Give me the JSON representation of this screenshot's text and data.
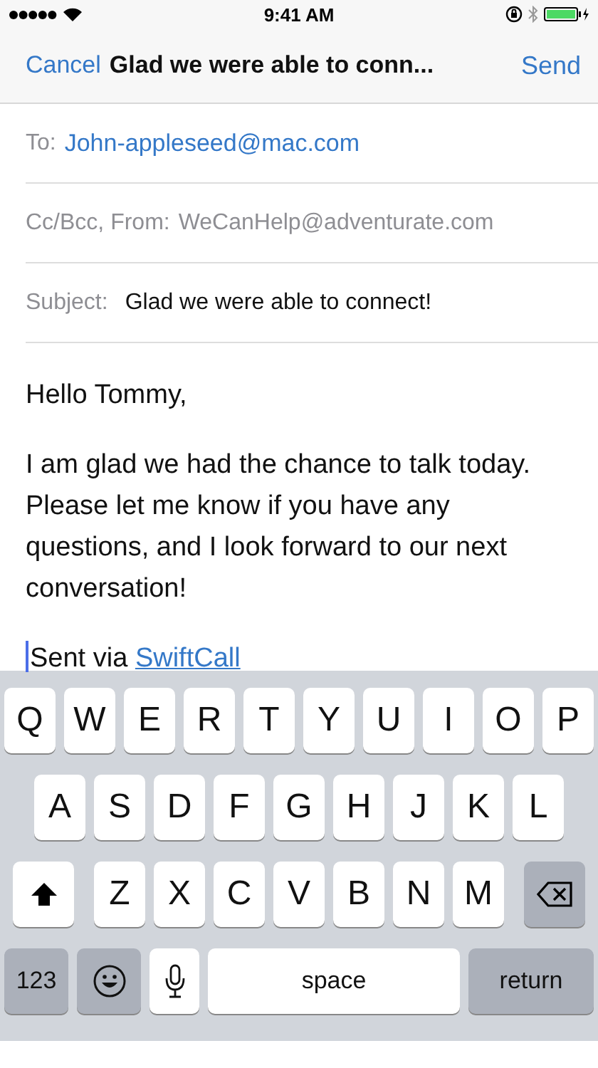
{
  "status_bar": {
    "time": "9:41 AM"
  },
  "nav": {
    "cancel": "Cancel",
    "title": "Glad we were able to conn...",
    "send": "Send"
  },
  "fields": [
    {
      "label": "To:",
      "value": "John-appleseed@mac.com",
      "kind": "recipient"
    },
    {
      "label": "Cc/Bcc, From:",
      "value": "WeCanHelp@adventurate.com",
      "kind": "muted"
    },
    {
      "label": "Subject:",
      "value": "Glad we were able to connect!",
      "kind": "plain"
    }
  ],
  "body": {
    "greeting": "Hello Tommy,",
    "paragraph": "I am glad we had the chance to talk today. Please let me know if you have any questions, and I look forward to our next conversation!",
    "signature": {
      "text": "Sent via",
      "link": "SwiftCall"
    }
  },
  "keyboard": {
    "rows": [
      {
        "keys": [
          {
            "kind": "letter",
            "label": "Q"
          },
          {
            "kind": "letter",
            "label": "W"
          },
          {
            "kind": "letter",
            "label": "E"
          },
          {
            "kind": "letter",
            "label": "R"
          },
          {
            "kind": "letter",
            "label": "T"
          },
          {
            "kind": "letter",
            "label": "Y"
          },
          {
            "kind": "letter",
            "label": "U"
          },
          {
            "kind": "letter",
            "label": "I"
          },
          {
            "kind": "letter",
            "label": "O"
          },
          {
            "kind": "letter",
            "label": "P"
          }
        ]
      },
      {
        "keys": [
          {
            "kind": "letter",
            "label": "A"
          },
          {
            "kind": "letter",
            "label": "S"
          },
          {
            "kind": "letter",
            "label": "D"
          },
          {
            "kind": "letter",
            "label": "F"
          },
          {
            "kind": "letter",
            "label": "G"
          },
          {
            "kind": "letter",
            "label": "H"
          },
          {
            "kind": "letter",
            "label": "J"
          },
          {
            "kind": "letter",
            "label": "K"
          },
          {
            "kind": "letter",
            "label": "L"
          }
        ]
      },
      {
        "keys": [
          {
            "kind": "shift"
          },
          {
            "kind": "letter",
            "label": "Z"
          },
          {
            "kind": "letter",
            "label": "X"
          },
          {
            "kind": "letter",
            "label": "C"
          },
          {
            "kind": "letter",
            "label": "V"
          },
          {
            "kind": "letter",
            "label": "B"
          },
          {
            "kind": "letter",
            "label": "N"
          },
          {
            "kind": "letter",
            "label": "M"
          },
          {
            "kind": "delete"
          }
        ]
      },
      {
        "keys": [
          {
            "kind": "numbers",
            "label": "123"
          },
          {
            "kind": "emoji"
          },
          {
            "kind": "mic"
          },
          {
            "kind": "space",
            "label": "space"
          },
          {
            "kind": "return",
            "label": "return"
          }
        ]
      }
    ]
  }
}
